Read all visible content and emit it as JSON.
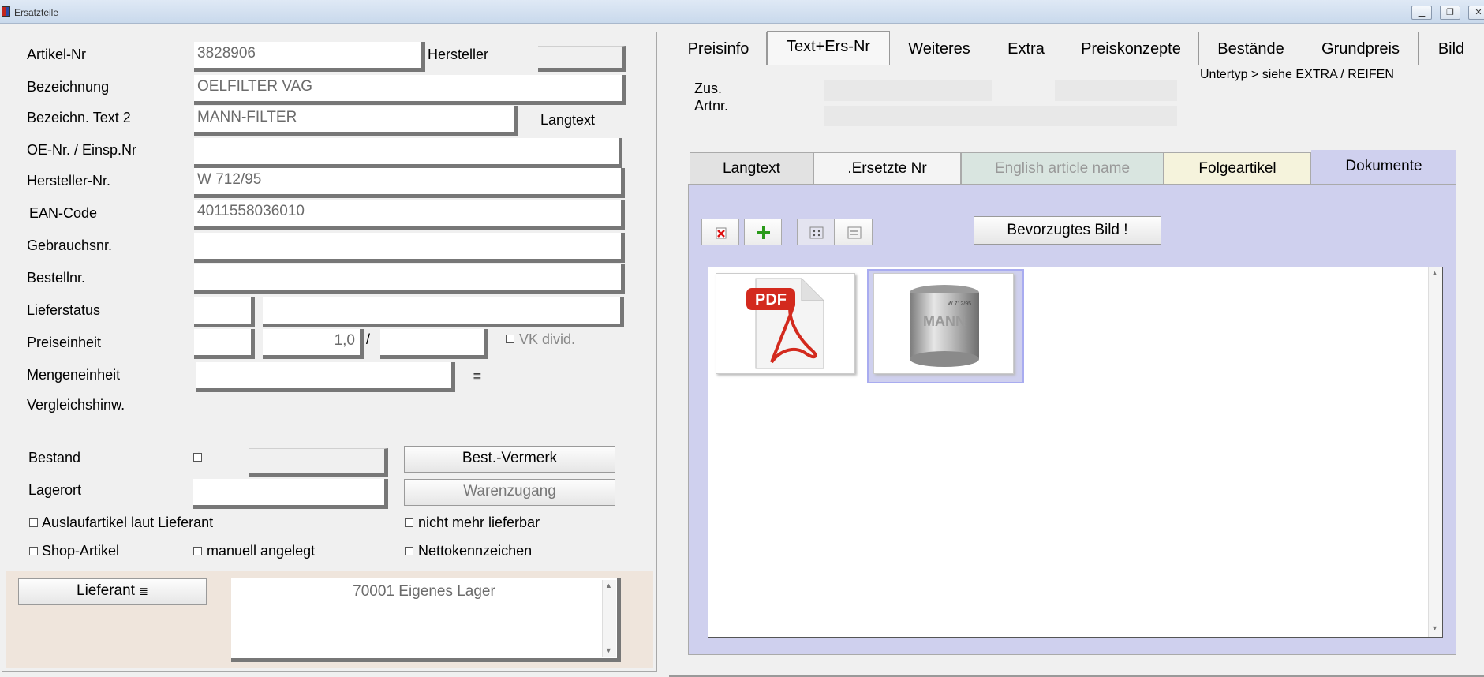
{
  "window": {
    "title": "Ersatzteile"
  },
  "form": {
    "artikel_nr": {
      "label": "Artikel-Nr",
      "value": "3828906"
    },
    "hersteller": {
      "label": "Hersteller",
      "value": ""
    },
    "bezeichnung": {
      "label": "Bezeichnung",
      "value": "OELFILTER VAG"
    },
    "bezeichn_text2": {
      "label": "Bezeichn. Text 2",
      "value": "MANN-FILTER"
    },
    "langtext_label": "Langtext",
    "oe_nr": {
      "label": "OE-Nr. / Einsp.Nr",
      "value": ""
    },
    "hersteller_nr": {
      "label": "Hersteller-Nr.",
      "value": "W 712/95"
    },
    "ean_code": {
      "label": "EAN-Code",
      "value": "4011558036010"
    },
    "gebrauchsnr": {
      "label": "Gebrauchsnr.",
      "value": ""
    },
    "bestellnr": {
      "label": "Bestellnr.",
      "value": ""
    },
    "lieferstatus": {
      "label": "Lieferstatus",
      "code": "",
      "text": ""
    },
    "preiseinheit": {
      "label": "Preiseinheit",
      "a": "",
      "b": "1,0",
      "slash": "/",
      "c": ""
    },
    "vk_divid": "VK divid.",
    "mengeneinheit": {
      "label": "Mengeneinheit",
      "value": ""
    },
    "vergleichshinw": {
      "label": "Vergleichshinw."
    },
    "bestand": {
      "label": "Bestand",
      "value": ""
    },
    "best_vermerk_btn": "Best.-Vermerk",
    "lagerort": {
      "label": "Lagerort",
      "value": ""
    },
    "warenzugang_btn": "Warenzugang",
    "auslaufartikel": "Auslaufartikel laut Lieferant",
    "nicht_mehr_lieferbar": "nicht mehr lieferbar",
    "shop_artikel": "Shop-Artikel",
    "manuell_angelegt": "manuell angelegt",
    "nettokennzeichen": "Nettokennzeichen",
    "lieferant_btn": "Lieferant",
    "lieferant_value": "70001 Eigenes Lager"
  },
  "tabs": [
    {
      "label": "Preisinfo"
    },
    {
      "label": "Text+Ers-Nr"
    },
    {
      "label": "Weiteres"
    },
    {
      "label": "Extra"
    },
    {
      "label": "Preiskonzepte"
    },
    {
      "label": "Bestände"
    },
    {
      "label": "Grundpreis"
    },
    {
      "label": "Bild"
    }
  ],
  "text_tab": {
    "untertyp_note": "Untertyp > siehe EXTRA / REIFEN",
    "zus_label": "Zus.",
    "artnr_label": "Artnr."
  },
  "subtabs": [
    {
      "label": "Langtext"
    },
    {
      "label": ".Ersetzte Nr"
    },
    {
      "label": "English article name"
    },
    {
      "label": "Folgeartikel"
    },
    {
      "label": "Dokumente"
    }
  ],
  "documents": {
    "preferred_image_btn": "Bevorzugtes Bild !",
    "pdf_badge": "PDF",
    "filter_brand": "MANN",
    "filter_model": "W 712/95"
  },
  "colors": {
    "docs_panel": "#cfd0ee",
    "folgeartikel_tab": "#f5f3dc",
    "english_tab": "#d9e5e0",
    "lieferant_section": "#efe5dc",
    "pdf_red": "#d32a1e"
  }
}
